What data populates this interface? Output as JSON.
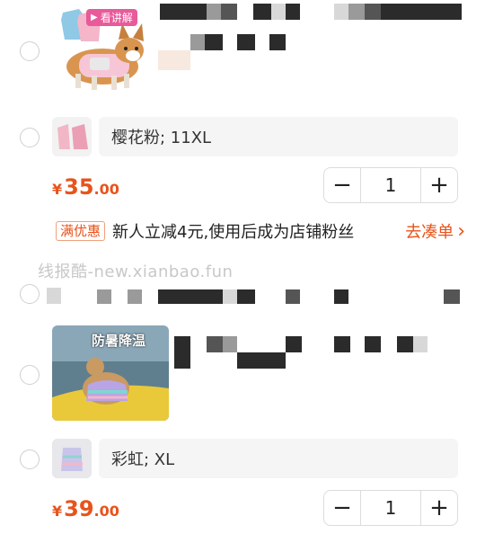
{
  "item1": {
    "video_badge": "看讲解",
    "variant": "樱花粉; 11XL",
    "price": {
      "currency": "¥",
      "integer": "35",
      "decimal": ".00"
    },
    "quantity": "1"
  },
  "promo": {
    "badge": "满优惠",
    "text": "新人立减4元,使用后成为店铺粉丝",
    "link": "去凑单",
    "chevron": "›"
  },
  "watermark": "线报酷-new.xianbao.fun",
  "item2": {
    "image_caption": "防暑降温",
    "variant": "彩虹; XL",
    "price": {
      "currency": "¥",
      "integer": "39",
      "decimal": ".00"
    },
    "quantity": "1"
  },
  "stepper": {
    "minus": "−",
    "plus": "+"
  },
  "colors": {
    "accent": "#e8531b",
    "badge_border": "#f0a17a"
  }
}
